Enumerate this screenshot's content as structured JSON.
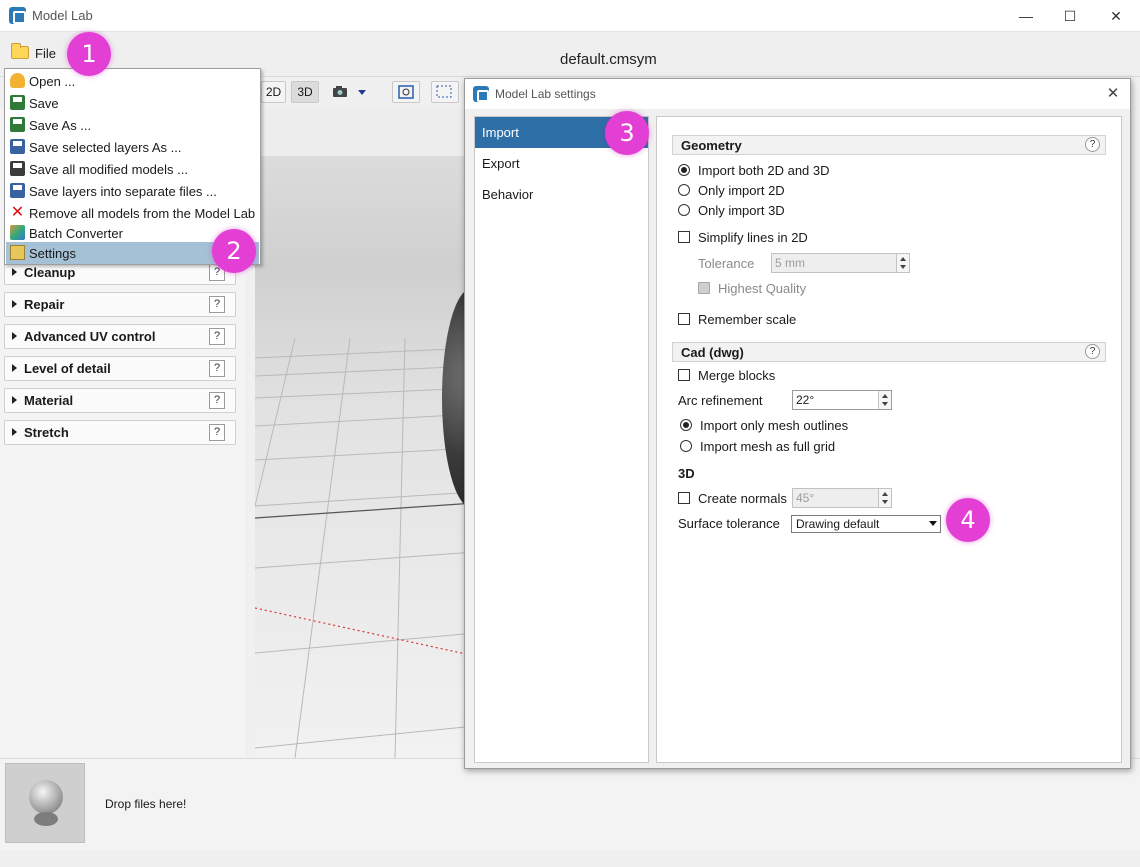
{
  "window": {
    "title": "Model Lab",
    "minimize": "—",
    "maximize": "☐",
    "close": "✕"
  },
  "menubar": {
    "file_label": "File",
    "document_title": "default.cmsym"
  },
  "toolbar": {
    "btn_2d": "2D",
    "btn_3d": "3D"
  },
  "file_menu": [
    {
      "label": "Open ...",
      "icon": "open-folder-icon"
    },
    {
      "label": "Save",
      "icon": "save-icon"
    },
    {
      "label": "Save As ...",
      "icon": "save-as-icon"
    },
    {
      "label": "Save selected layers As ...",
      "icon": "save-layers-icon"
    },
    {
      "label": "Save all modified models ...",
      "icon": "save-all-icon"
    },
    {
      "label": "Save layers into separate files ...",
      "icon": "save-separate-icon"
    },
    {
      "label": "Remove all models from the Model Lab",
      "icon": "remove-icon"
    },
    {
      "label": "Batch Converter",
      "icon": "batch-converter-icon"
    },
    {
      "label": "Settings",
      "icon": "settings-icon"
    }
  ],
  "left_panel": {
    "sections": [
      {
        "label": "Cleanup",
        "help": "?"
      },
      {
        "label": "Repair",
        "help": "?"
      },
      {
        "label": "Advanced UV control",
        "help": "?"
      },
      {
        "label": "Level of detail",
        "help": "?"
      },
      {
        "label": "Material",
        "help": "?"
      },
      {
        "label": "Stretch",
        "help": "?"
      }
    ]
  },
  "drop_area": {
    "text": "Drop files here!"
  },
  "badges": [
    "1",
    "2",
    "3",
    "4"
  ],
  "settings": {
    "title": "Model Lab settings",
    "close": "✕",
    "nav": [
      {
        "label": "Import"
      },
      {
        "label": "Export"
      },
      {
        "label": "Behavior"
      }
    ],
    "geometry": {
      "title": "Geometry",
      "help": "?",
      "radio_both": "Import both 2D and 3D",
      "radio_2d": "Only import 2D",
      "radio_3d": "Only import 3D",
      "simplify": "Simplify lines in 2D",
      "tolerance_label": "Tolerance",
      "tolerance_value": "5 mm",
      "highest_quality": "Highest Quality",
      "remember_scale": "Remember scale"
    },
    "cad": {
      "title": "Cad (dwg)",
      "help": "?",
      "merge_blocks": "Merge blocks",
      "arc_label": "Arc refinement",
      "arc_value": "22°",
      "outlines": "Import only mesh outlines",
      "full_grid": "Import mesh as full grid"
    },
    "three_d": {
      "title": "3D",
      "create_normals": "Create normals",
      "normals_value": "45°",
      "surface_label": "Surface tolerance",
      "surface_value": "Drawing default"
    }
  }
}
